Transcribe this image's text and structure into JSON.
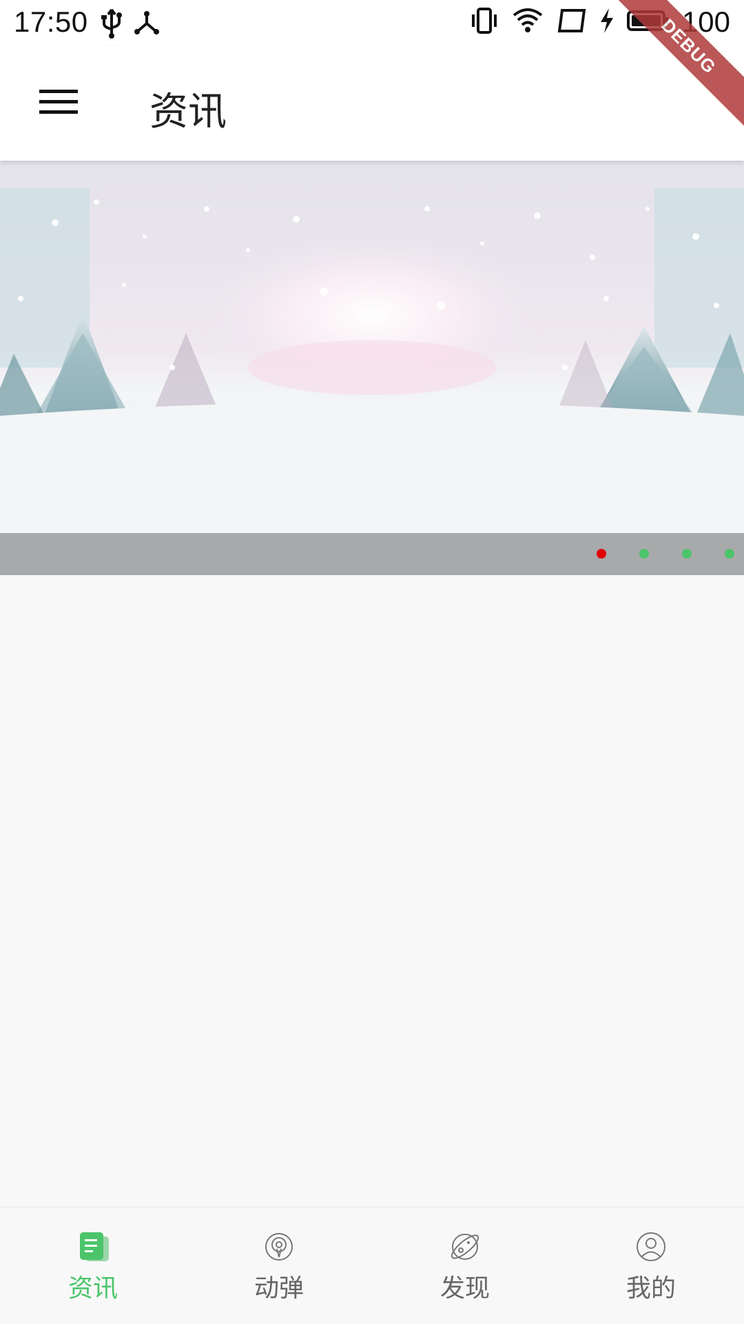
{
  "status_bar": {
    "time": "17:50",
    "battery": "100",
    "icons_left": [
      "usb-icon",
      "network-share-icon"
    ],
    "icons_right": [
      "vibrate-icon",
      "wifi-icon",
      "cast-icon",
      "charging-icon",
      "battery-icon"
    ]
  },
  "debug_banner": "DEBUG",
  "app_bar": {
    "title": "资讯",
    "menu_icon": "hamburger-menu-icon"
  },
  "banner": {
    "image": "snowy-winter-forest",
    "indicators": [
      {
        "active": true,
        "color": "#e00000"
      },
      {
        "active": false,
        "color": "#4cc46a"
      },
      {
        "active": false,
        "color": "#4cc46a"
      },
      {
        "active": false,
        "color": "#4cc46a"
      }
    ]
  },
  "bottom_nav": {
    "items": [
      {
        "label": "资讯",
        "icon": "news-icon",
        "active": true
      },
      {
        "label": "动弹",
        "icon": "podcast-icon",
        "active": false
      },
      {
        "label": "发现",
        "icon": "planet-icon",
        "active": false
      },
      {
        "label": "我的",
        "icon": "user-icon",
        "active": false
      }
    ]
  },
  "colors": {
    "accent": "#4cc46a",
    "indicator_active": "#e00000",
    "indicator_bar": "#a8a9ab"
  }
}
